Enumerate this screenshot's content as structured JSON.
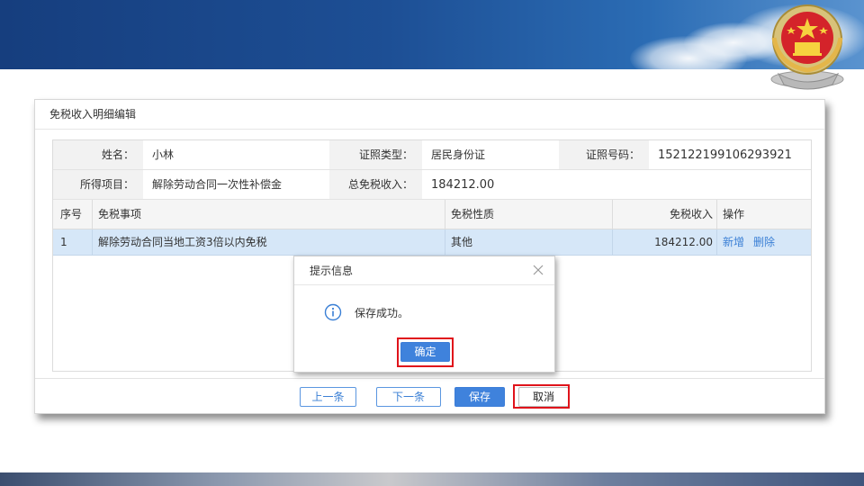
{
  "dialog": {
    "title": "免税收入明细编辑",
    "info": {
      "name_label": "姓名：",
      "name_value": "小林",
      "id_type_label": "证照类型：",
      "id_type_value": "居民身份证",
      "id_number_label": "证照号码：",
      "id_number_value": "152122199106293921",
      "income_item_label": "所得项目：",
      "income_item_value": "解除劳动合同一次性补偿金",
      "total_label": "总免税收入：",
      "total_value": "184212.00"
    },
    "table": {
      "headers": [
        "序号",
        "免税事项",
        "免税性质",
        "免税收入",
        "操作"
      ],
      "rows": [
        {
          "seq": "1",
          "item": "解除劳动合同当地工资3倍以内免税",
          "nature": "其他",
          "income": "184212.00",
          "actions": [
            "新增",
            "删除"
          ]
        }
      ]
    },
    "footer": {
      "prev": "上一条",
      "next": "下一条",
      "save": "保存",
      "cancel": "取消"
    }
  },
  "popup": {
    "title": "提示信息",
    "message": "保存成功。",
    "confirm": "确定",
    "icons": {
      "close": "close-icon",
      "info": "info-icon"
    }
  },
  "colors": {
    "banner": "#1d4f95",
    "primary_button": "#3f82dc",
    "link": "#3a7fd5",
    "selected_row": "#d6e7f8",
    "highlight_frame": "#e0131b"
  }
}
